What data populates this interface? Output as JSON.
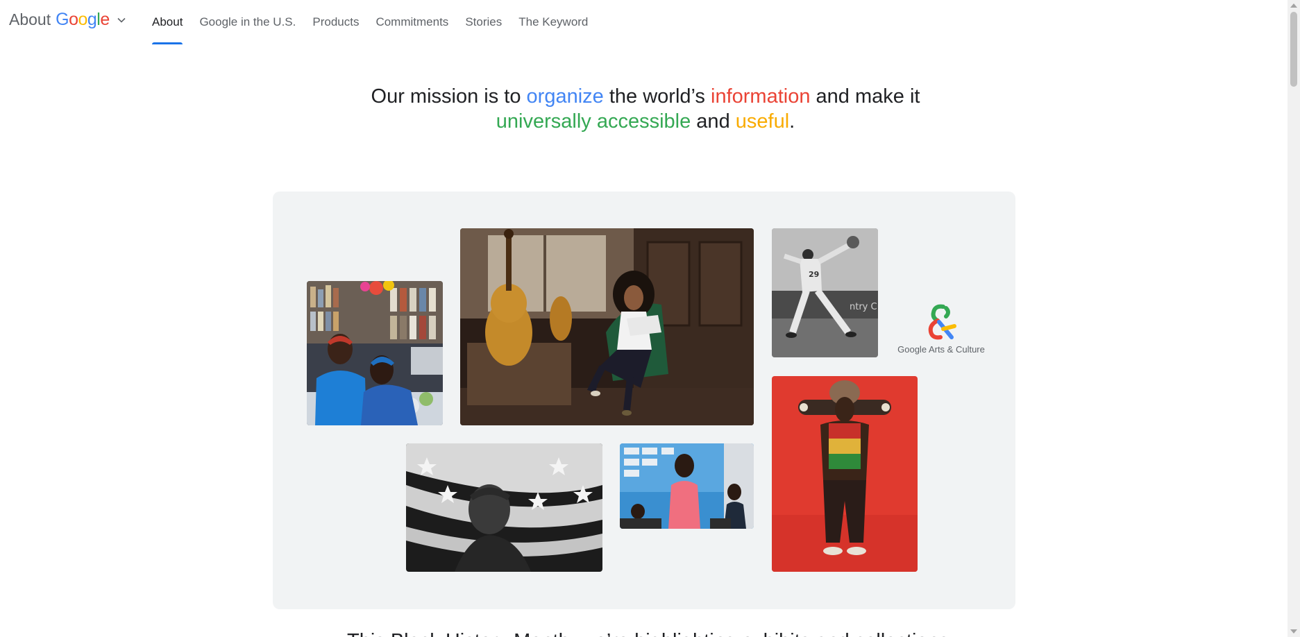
{
  "header": {
    "brand_about": "About",
    "brand_google_letters": [
      "G",
      "o",
      "o",
      "g",
      "l",
      "e"
    ],
    "nav": [
      {
        "label": "About",
        "active": true
      },
      {
        "label": "Google in the U.S.",
        "active": false
      },
      {
        "label": "Products",
        "active": false
      },
      {
        "label": "Commitments",
        "active": false
      },
      {
        "label": "Stories",
        "active": false
      },
      {
        "label": "The Keyword",
        "active": false
      }
    ],
    "accent_color": "#1a73e8"
  },
  "mission": {
    "part1": "Our mission is to ",
    "organize": "organize",
    "part2": " the world’s ",
    "information": "information",
    "part3": " and make it",
    "universally_accessible": "universally accessible",
    "part4": " and ",
    "useful": "useful",
    "part5": ".",
    "colors": {
      "blue": "#4285f4",
      "red": "#ea4335",
      "green": "#34a853",
      "yellow": "#f9ab00"
    }
  },
  "collage": {
    "background": "#f1f3f4",
    "arts_culture_label": "Google Arts & Culture",
    "photos": [
      "market-stall-women-photo",
      "cellist-woman-photo",
      "baseball-pitcher-photo",
      "skateboarder-red-photo",
      "flag-portrait-photo",
      "classroom-teacher-photo"
    ]
  },
  "teaser": {
    "text": "This Black History Month, we’re highlighting exhibits and collections"
  }
}
